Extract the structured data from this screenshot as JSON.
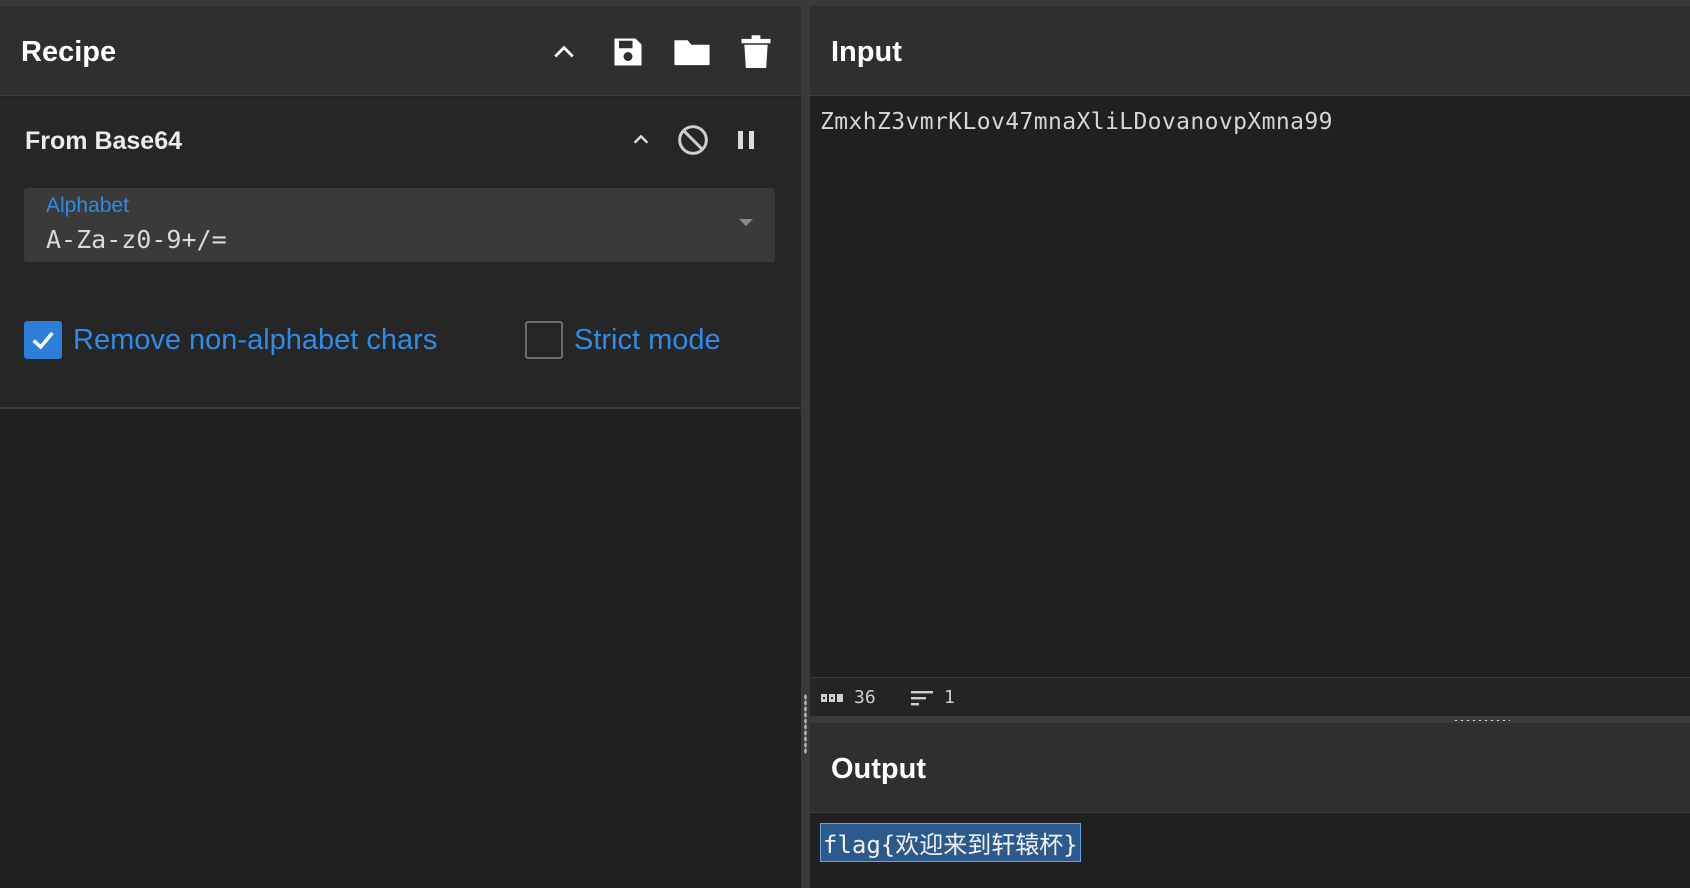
{
  "recipe": {
    "title": "Recipe",
    "operation": {
      "name": "From Base64",
      "alphabet_label": "Alphabet",
      "alphabet_value": "A-Za-z0-9+/=",
      "remove_non_alphabet": {
        "label": "Remove non-alphabet chars",
        "checked": true
      },
      "strict_mode": {
        "label": "Strict mode",
        "checked": false
      }
    }
  },
  "input": {
    "title": "Input",
    "text": "ZmxhZ3vmrKLov47mnaXliLDovanovpXmna99",
    "char_count": "36",
    "line_count": "1"
  },
  "output": {
    "title": "Output",
    "text": "flag{欢迎来到轩辕杯}"
  },
  "colors": {
    "accent": "#2b7fd9",
    "background": "#202020",
    "header": "#2f2f2f"
  }
}
